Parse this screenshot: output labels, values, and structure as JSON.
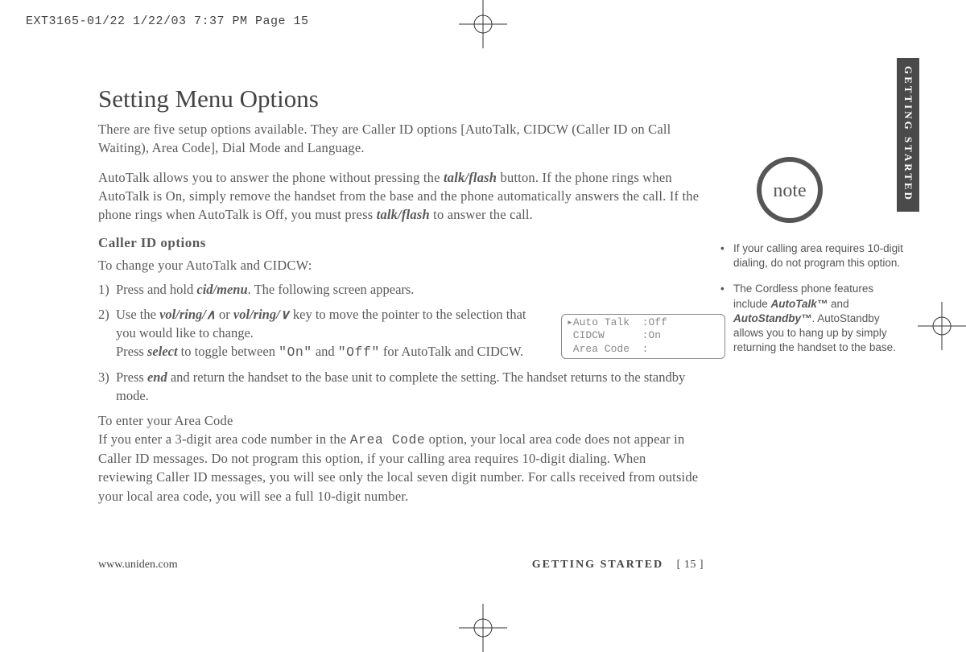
{
  "slug": "EXT3165-01/22  1/22/03  7:37 PM  Page 15",
  "section_tab": "GETTING STARTED",
  "title": "Setting Menu Options",
  "intro": "There are five setup options available. They are Caller ID options [AutoTalk, CIDCW (Caller ID on Call Waiting), Area Code], Dial Mode and Language.",
  "autotalk_para_a": "AutoTalk allows you to answer the phone without pressing the ",
  "btn_talkflash": "talk/flash",
  "autotalk_para_b": " button. If the phone rings when AutoTalk is On, simply remove the handset from the base and the phone automatically answers the call. If the phone rings when AutoTalk is Off, you must press ",
  "autotalk_para_c": " to answer the call.",
  "sub_callerid": "Caller ID options",
  "line_change": "To change your AutoTalk and CIDCW:",
  "steps": {
    "s1a": "Press and hold ",
    "s1_btn": "cid/menu",
    "s1b": ". The following screen appears.",
    "s2a": "Use the ",
    "s2_btn1": "vol/ring/",
    "s2b": " or ",
    "s2_btn2": "vol/ring/",
    "s2c": " key to move the pointer to the selection that you would like to change.",
    "s2d_a": "Press ",
    "s2d_btn": "select",
    "s2d_b": " to toggle between ",
    "s2_on": "\"On\"",
    "s2d_c": " and ",
    "s2_off": "\"Off\"",
    "s2d_d": " for AutoTalk and CIDCW.",
    "s3a": "Press ",
    "s3_btn": "end",
    "s3b": " and return the handset to the base unit to complete the setting. The handset returns to the standby mode."
  },
  "area_lead": "To enter your Area Code",
  "area_a": "If you enter a 3-digit area code number in the ",
  "area_code_lcd": "Area Code",
  "area_b": " option, your local area code does not appear in Caller ID messages. Do not program this option, if your calling area requires 10-digit dialing. When reviewing Caller ID messages, you will see only the local seven digit number. For calls received from outside your local area code, you will see a full 10-digit number.",
  "lcd": "▸Auto Talk  :Off\n CIDCW      :On\n Area Code  :",
  "note_label": "note",
  "side1": "If your calling area requires 10-digit dialing, do not program this option.",
  "side2_a": "The Cordless phone features include ",
  "side2_at": "AutoTalk™",
  "side2_b": " and ",
  "side2_as": "AutoStandby™",
  "side2_c": ". AutoStandby allows you to hang up by simply returning the handset to the base.",
  "footer_url": "www.uniden.com",
  "footer_section": "GETTING STARTED",
  "footer_page": "[ 15 ]"
}
